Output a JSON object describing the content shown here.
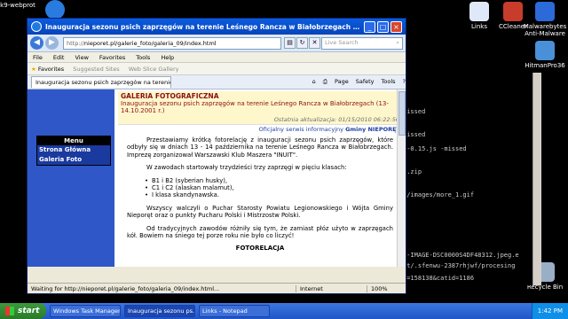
{
  "desktop": {
    "icons": [
      {
        "label": "k9-webprot"
      },
      {
        "label": "Links"
      },
      {
        "label": "CCleaner"
      },
      {
        "label": "Malwarebytes Anti-Malware"
      },
      {
        "label": "HitmanPro36"
      },
      {
        "label": "Recycle Bin"
      }
    ],
    "notepad_lines": [
      "missed",
      "missed",
      "e-0.15.js -missed",
      "2.zip",
      "l/images/more_1.gif",
      "y-IMAGE-DSC0000S4DF48312.jpeg.e",
      "rt/.sfenwu-2387rhjwf/procesing",
      "d=158138&catid=1186"
    ]
  },
  "window": {
    "title": "Inauguracja sezonu psich zaprzęgów na terenie Leśnego Rancza w Białobrzegach (13-14.10.2001 r.) - Windo...",
    "address_prefix": "http://",
    "address": "nieporet.pl/galerie_foto/galeria_09/index.html",
    "search_placeholder": "Live Search",
    "menu": [
      "File",
      "Edit",
      "View",
      "Favorites",
      "Tools",
      "Help"
    ],
    "favorites_label": "Favorites",
    "suggested_sites": "Suggested Sites",
    "web_slice_gallery": "Web Slice Gallery",
    "tab_label": "Inauguracja sezonu psich zaprzęgów na terenie Leśn...",
    "tools": [
      "Page",
      "Safety",
      "Tools"
    ],
    "status_text": "Waiting for http://nieporet.pl/galerie_foto/galeria_09/index.html...",
    "zone": "Internet",
    "zoom": "100%"
  },
  "page": {
    "menu_header": "Menu",
    "menu_links": [
      "Strona Główna",
      "Galeria Foto"
    ],
    "heading": "GALERIA FOTOGRAFICZNA",
    "subheading": "Inauguracja sezonu psich zaprzęgów na terenie Leśnego Rancza w Białobrzegach (13-14.10.2001 r.)",
    "updated": "Ostatnia aktualizacja: 01/15/2010 06:22:50",
    "official_prefix": "Oficjalny serwis informacyjny",
    "official_name": "Gminy NIEPORĘT",
    "para1": "Przestawiamy krótką fotorelację z inauguracji sezonu psich zaprzęgów, które odbyły się w dniach 13 - 14 października na terenie Leśnego Rancza w Białobrzegach. Imprezę zorganizował Warszawski Klub Maszera \"INUIT\".",
    "para2": "W zawodach startowały trzydzieści trzy zaprzęgi w pięciu klasach:",
    "classes": [
      "B1 i B2 (syberian husky),",
      "C1 i C2 (alaskan malamut),",
      "I klasa skandynawska."
    ],
    "para3": "Wszyscy walczyli o Puchar Starosty Powiatu Legionowskiego i Wójta Gminy Nieporęt oraz o punkty Pucharu Polski i Mistrzostw Polski.",
    "para4": "Od tradycyjnych zawodów różniły się tym, że zamiast płóz użyto w zaprzęgach kół. Bowiem na śniego tej porze roku nie było co liczyć!",
    "fotorelacja": "FOTORELACJA"
  },
  "taskbar": {
    "start": "start",
    "buttons": [
      "Windows Task Manager",
      "Inauguracja sezonu ps...",
      "Links - Notepad"
    ],
    "clock": "1:42 PM"
  }
}
